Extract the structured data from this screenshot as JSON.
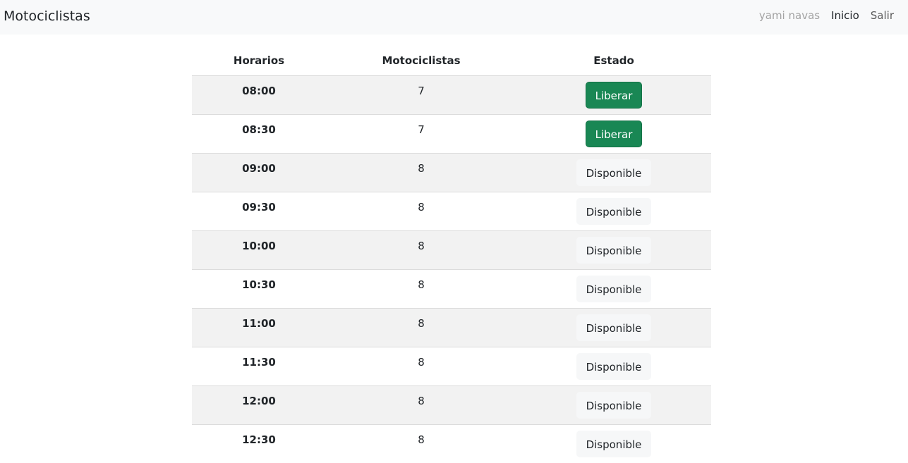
{
  "navbar": {
    "brand": "Motociclistas",
    "user": "yami navas",
    "links": [
      "Inicio",
      "Salir"
    ]
  },
  "table": {
    "headers": [
      "Horarios",
      "Motociclistas",
      "Estado"
    ],
    "rows": [
      {
        "hora": "08:00",
        "motociclistas": "7",
        "estado": "Liberar",
        "tipo": "success"
      },
      {
        "hora": "08:30",
        "motociclistas": "7",
        "estado": "Liberar",
        "tipo": "success"
      },
      {
        "hora": "09:00",
        "motociclistas": "8",
        "estado": "Disponible",
        "tipo": "light"
      },
      {
        "hora": "09:30",
        "motociclistas": "8",
        "estado": "Disponible",
        "tipo": "light"
      },
      {
        "hora": "10:00",
        "motociclistas": "8",
        "estado": "Disponible",
        "tipo": "light"
      },
      {
        "hora": "10:30",
        "motociclistas": "8",
        "estado": "Disponible",
        "tipo": "light"
      },
      {
        "hora": "11:00",
        "motociclistas": "8",
        "estado": "Disponible",
        "tipo": "light"
      },
      {
        "hora": "11:30",
        "motociclistas": "8",
        "estado": "Disponible",
        "tipo": "light"
      },
      {
        "hora": "12:00",
        "motociclistas": "8",
        "estado": "Disponible",
        "tipo": "light"
      },
      {
        "hora": "12:30",
        "motociclistas": "8",
        "estado": "Disponible",
        "tipo": "light"
      }
    ]
  },
  "colors": {
    "success": "#198754",
    "navbar_bg": "#f8f9fa",
    "striped_row": "#f2f2f2"
  }
}
